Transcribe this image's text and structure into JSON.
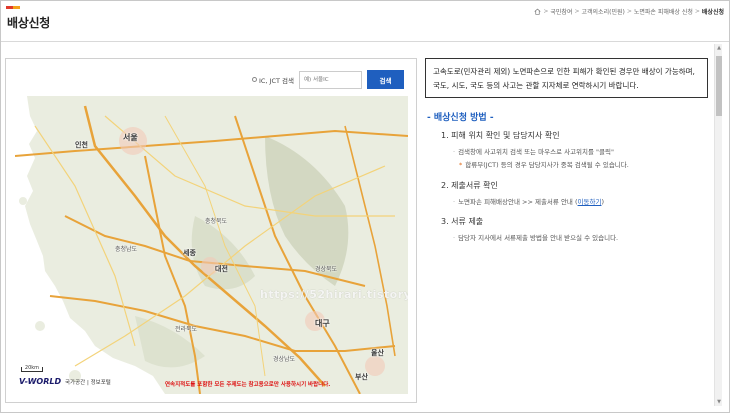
{
  "page": {
    "title": "배상신청",
    "accent_colors": [
      "#e03a2c",
      "#f3a21d"
    ]
  },
  "breadcrumb": {
    "items": [
      "국민참여",
      "고객의소리(민원)",
      "노면파손 피해배상 신청"
    ],
    "current": "배상신청",
    "separator": ">"
  },
  "search": {
    "radio_label": "IC, JCT 검색",
    "placeholder": "예) 서울IC",
    "button_label": "검색"
  },
  "map": {
    "labels": {
      "incheon": "인천",
      "seoul": "서울",
      "chungbuk": "충청북도",
      "chungnam": "충청남도",
      "sejong": "세종",
      "daejeon": "대전",
      "gyeongbuk": "경상북도",
      "jeonbuk": "전라북도",
      "daegu": "대구",
      "ulsan": "울산",
      "busan": "부산",
      "gyeongnam": "경상남도"
    },
    "watermark": "https://52hirari.tistory.com",
    "brand": "V-WORLD",
    "extra": "국가공간 | 정보포털",
    "scale": "20km",
    "notice": "연속지적도를 포함한 모든 주제도는 참고용으로만 사용하시기 바랍니다.",
    "colors": {
      "highway": "#e8a33a",
      "road": "#f3d37a",
      "mountain": "#d7dcc7",
      "sea": "#ffffff"
    }
  },
  "notice": {
    "text": "고속도로(민자관리 제외) 노면파손으로 인한 피해가 확인된 경우만 배상이 가능하며, 국도, 시도, 국도 등의 사고는 관할 지자체로 연락하시기 바랍니다."
  },
  "guide": {
    "title": "- 배상신청 방법 -",
    "steps": [
      {
        "label": "1. 피해 위치 확인 및 담당지사 확인",
        "subs": [
          "검색창에 사고위치 검색 또는 마우스로 사고위치를 \"클릭\""
        ],
        "note": "합류부(JCT) 등의 경우 담당지사가 중복 검색될 수 있습니다."
      },
      {
        "label": "2. 제출서류 확인",
        "sub_prefix": "노면파손 피해배상안내 >> 제출서류 안내 (",
        "sub_link": "이동하기",
        "sub_suffix": ")"
      },
      {
        "label": "3. 서류 제출",
        "subs": [
          "담당자 지사에서 서류제출 방법을 안내 받으실 수 있습니다."
        ]
      }
    ]
  },
  "icons": {
    "home": "home-icon",
    "radio": "radio-icon"
  }
}
